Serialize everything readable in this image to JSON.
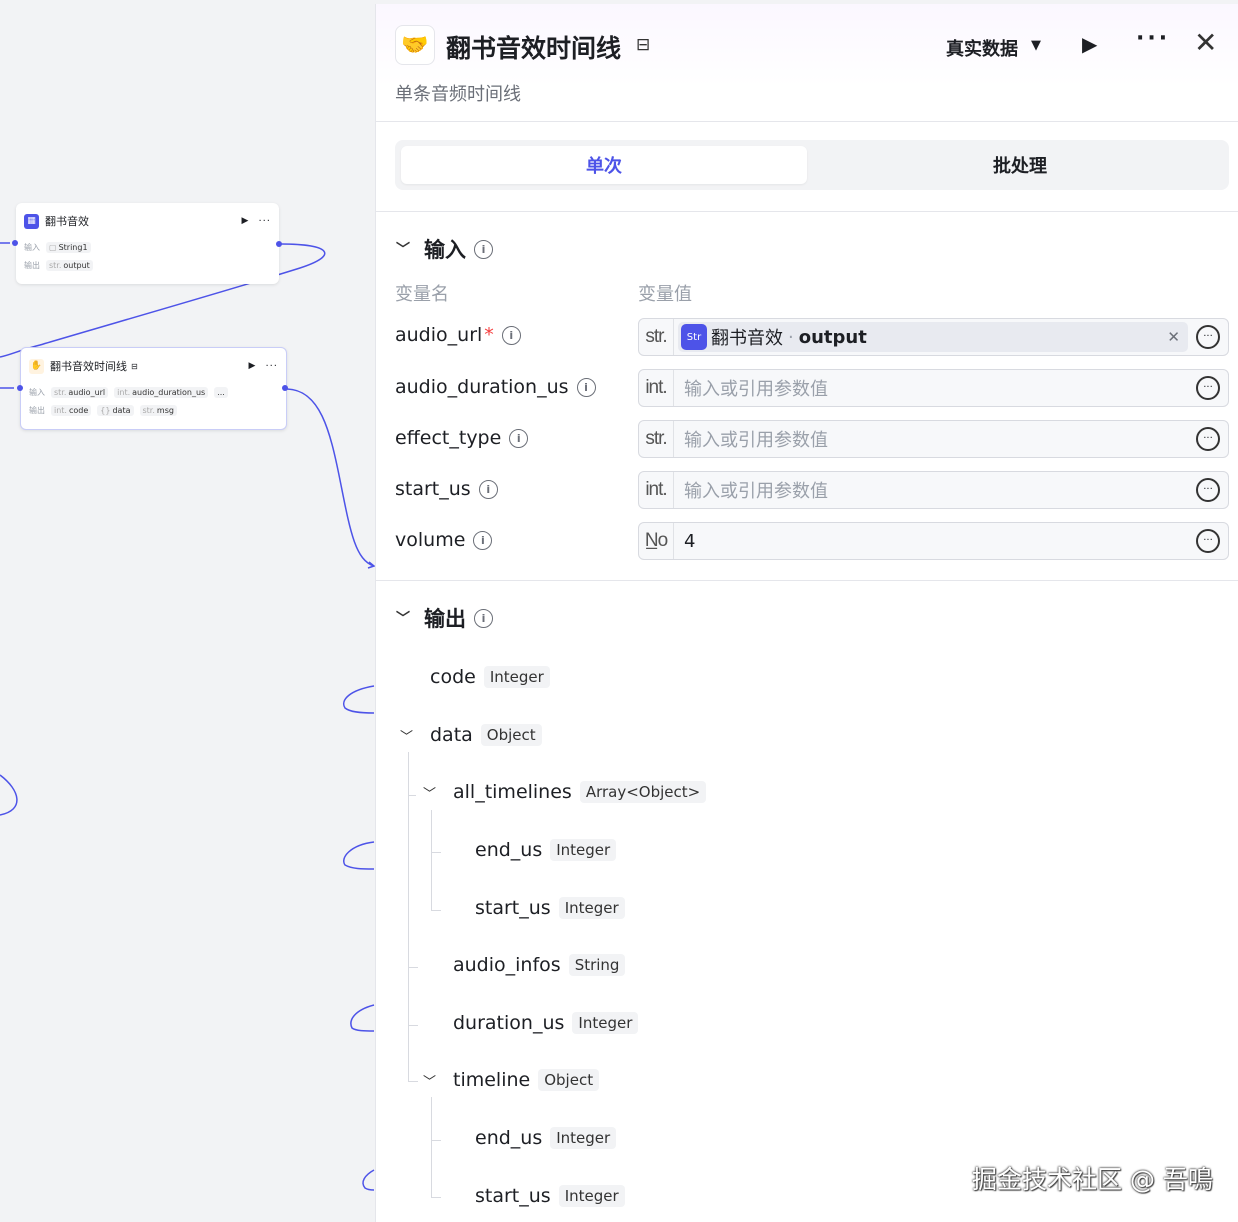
{
  "canvas": {
    "node1": {
      "title": "翻书音效",
      "in_label": "输入",
      "in_value": "String1",
      "out_label": "输出",
      "out_type": "str.",
      "out_value": "output"
    },
    "node2": {
      "title": "翻书音效时间线",
      "in_label": "输入",
      "in_type1": "str.",
      "in_value1": "audio_url",
      "in_type2": "int.",
      "in_value2": "audio_duration_us",
      "in_more": "...",
      "out_label": "输出",
      "out_type1": "int.",
      "out_value1": "code",
      "out_value2": "data",
      "out_type3": "str.",
      "out_value3": "msg"
    }
  },
  "panel": {
    "title": "翻书音效时间线",
    "subtitle": "单条音频时间线",
    "data_mode": "真实数据",
    "tabs": [
      "单次",
      "批处理"
    ],
    "input_section": "输入",
    "col_name": "变量名",
    "col_value": "变量值",
    "inputs": [
      {
        "name": "audio_url",
        "required": "*",
        "type": "str.",
        "ref_node": "翻书音效",
        "ref_var": "output"
      },
      {
        "name": "audio_duration_us",
        "type": "int.",
        "placeholder": "输入或引用参数值"
      },
      {
        "name": "effect_type",
        "type": "str.",
        "placeholder": "输入或引用参数值"
      },
      {
        "name": "start_us",
        "type": "int.",
        "placeholder": "输入或引用参数值"
      },
      {
        "name": "volume",
        "type": "N̲o",
        "value": "4"
      }
    ],
    "output_section": "输出",
    "outputs": [
      {
        "name": "code",
        "type": "Integer"
      },
      {
        "name": "data",
        "type": "Object"
      },
      {
        "name": "all_timelines",
        "type": "Array<Object>"
      },
      {
        "name": "end_us",
        "type": "Integer"
      },
      {
        "name": "start_us",
        "type": "Integer"
      },
      {
        "name": "audio_infos",
        "type": "String"
      },
      {
        "name": "duration_us",
        "type": "Integer"
      },
      {
        "name": "timeline",
        "type": "Object"
      },
      {
        "name": "end_us",
        "type": "Integer"
      },
      {
        "name": "start_us",
        "type": "Integer"
      }
    ]
  },
  "watermark": "掘金技术社区 @ 吾鳴",
  "colors": {
    "accent": "#4d53e8",
    "required": "#f53f3f"
  }
}
